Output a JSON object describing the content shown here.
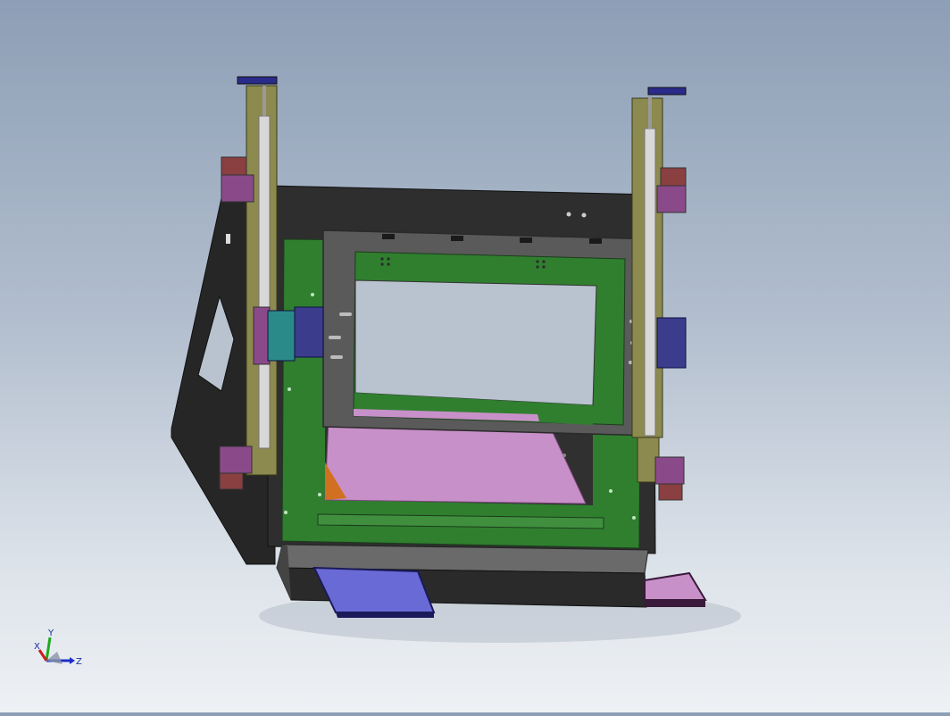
{
  "viewport": {
    "background_top": "#8d9fb6",
    "background_bottom": "#eef1f4"
  },
  "model": {
    "parts": [
      "frame-housing",
      "left-linear-rail",
      "right-linear-rail",
      "gray-window-frame",
      "green-mounting-plate",
      "pink-bed-plate",
      "front-drawer",
      "side-drawer"
    ],
    "colors": {
      "housing": "#2b2b2b",
      "rail": "#8c8a4e",
      "window_frame": "#5a5a5a",
      "green_plate": "#2f7f2f",
      "pink_plate": "#c890c8",
      "blue_drawer": "#6a6ad6",
      "purple_bracket": "#8a4a8a",
      "teal_bracket": "#2a8a8a",
      "navy_block": "#3c3c8c",
      "orange_wedge": "#d07020",
      "maroon_clip": "#7a3c3c"
    }
  },
  "triad": {
    "x_label": "X",
    "y_label": "Y",
    "z_label": "Z",
    "x_color": "#c81e1e",
    "y_color": "#1eaa1e",
    "z_color": "#1e2ec8"
  }
}
